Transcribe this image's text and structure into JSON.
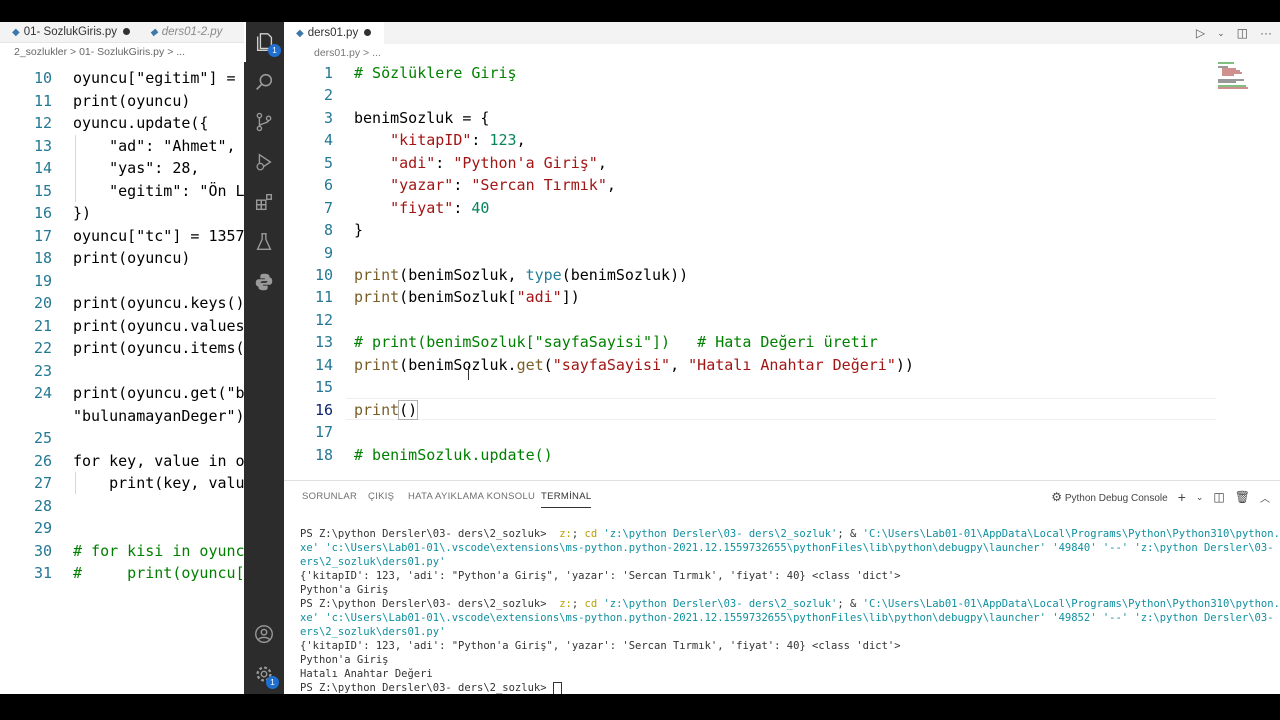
{
  "left_window": {
    "tabs": [
      {
        "label": "01- SozlukGiris.py"
      },
      {
        "label": "ders01-2.py"
      }
    ],
    "breadcrumb": "2_sozlukler  >  01- SozlukGiris.py > ...",
    "lines": [
      {
        "n": "10",
        "code": "oyuncu[\"egitim\"] = "
      },
      {
        "n": "11",
        "code": "print(oyuncu)"
      },
      {
        "n": "12",
        "code": "oyuncu.update({"
      },
      {
        "n": "13",
        "code": "    \"ad\": \"Ahmet\","
      },
      {
        "n": "14",
        "code": "    \"yas\": 28,"
      },
      {
        "n": "15",
        "code": "    \"egitim\": \"Ön L"
      },
      {
        "n": "16",
        "code": "})"
      },
      {
        "n": "17",
        "code": "oyuncu[\"tc\"] = 1357"
      },
      {
        "n": "18",
        "code": "print(oyuncu)"
      },
      {
        "n": "19",
        "code": ""
      },
      {
        "n": "20",
        "code": "print(oyuncu.keys()"
      },
      {
        "n": "21",
        "code": "print(oyuncu.values"
      },
      {
        "n": "22",
        "code": "print(oyuncu.items("
      },
      {
        "n": "23",
        "code": ""
      },
      {
        "n": "24",
        "code": "print(oyuncu.get(\"b"
      },
      {
        "n": "",
        "code": "\"bulunamayanDeger\")"
      },
      {
        "n": "25",
        "code": ""
      },
      {
        "n": "26",
        "code": "for key, value in o"
      },
      {
        "n": "27",
        "code": "    print(key, valu"
      },
      {
        "n": "28",
        "code": ""
      },
      {
        "n": "29",
        "code": ""
      },
      {
        "n": "30",
        "code": "# for kisi in oyunc"
      },
      {
        "n": "31",
        "code": "#     print(oyuncu["
      }
    ]
  },
  "activity_bar": {
    "items": [
      "explorer-icon",
      "search-icon",
      "source-control-icon",
      "run-debug-icon",
      "extensions-icon",
      "testing-icon",
      "python-icon"
    ],
    "explorer_badge": "1",
    "settings_badge": "1",
    "bottom": [
      "account-icon",
      "manage-gear-icon"
    ]
  },
  "editor": {
    "tab_label": "ders01.py",
    "breadcrumb": "ders01.py > ...",
    "line_numbers": [
      "1",
      "2",
      "3",
      "4",
      "5",
      "6",
      "7",
      "8",
      "9",
      "10",
      "11",
      "12",
      "13",
      "14",
      "15",
      "16",
      "17",
      "18"
    ]
  },
  "panel": {
    "tabs": [
      "SORUNLAR",
      "ÇIKIŞ",
      "HATA AYIKLAMA KONSOLU",
      "TERMİNAL"
    ],
    "terminal_name": "Python Debug Console",
    "terminal_lines": [
      [
        {
          "t": "PS Z:\\python Dersler\\03- ders\\2_sozluk> ",
          "c": ""
        },
        {
          "t": " z:",
          "c": "t-y"
        },
        {
          "t": "; ",
          "c": ""
        },
        {
          "t": "cd ",
          "c": "t-y"
        },
        {
          "t": "'z:\\python Dersler\\03- ders\\2_sozluk'",
          "c": "t-c"
        },
        {
          "t": "; & ",
          "c": ""
        },
        {
          "t": "'C:\\Users\\Lab01-01\\AppData\\Local\\Programs\\Python\\Python310\\python.e",
          "c": "t-c"
        }
      ],
      [
        {
          "t": "xe' 'c:\\Users\\Lab01-01\\.vscode\\extensions\\ms-python.python-2021.12.1559732655\\pythonFiles\\lib\\python\\debugpy\\launcher' '49840' '--' 'z:\\python Dersler\\03- d",
          "c": "t-c"
        }
      ],
      [
        {
          "t": "ers\\2_sozluk\\ders01.py'",
          "c": "t-c"
        }
      ],
      [
        {
          "t": "{'kitapID': 123, 'adi': \"Python'a Giriş\", 'yazar': 'Sercan Tırmık', 'fiyat': 40} <class 'dict'>",
          "c": ""
        }
      ],
      [
        {
          "t": "Python'a Giriş",
          "c": ""
        }
      ],
      [
        {
          "t": "PS Z:\\python Dersler\\03- ders\\2_sozluk> ",
          "c": ""
        },
        {
          "t": " z:",
          "c": "t-y"
        },
        {
          "t": "; ",
          "c": ""
        },
        {
          "t": "cd ",
          "c": "t-y"
        },
        {
          "t": "'z:\\python Dersler\\03- ders\\2_sozluk'",
          "c": "t-c"
        },
        {
          "t": "; & ",
          "c": ""
        },
        {
          "t": "'C:\\Users\\Lab01-01\\AppData\\Local\\Programs\\Python\\Python310\\python.e",
          "c": "t-c"
        }
      ],
      [
        {
          "t": "xe' 'c:\\Users\\Lab01-01\\.vscode\\extensions\\ms-python.python-2021.12.1559732655\\pythonFiles\\lib\\python\\debugpy\\launcher' '49852' '--' 'z:\\python Dersler\\03- d",
          "c": "t-c"
        }
      ],
      [
        {
          "t": "ers\\2_sozluk\\ders01.py'",
          "c": "t-c"
        }
      ],
      [
        {
          "t": "{'kitapID': 123, 'adi': \"Python'a Giriş\", 'yazar': 'Sercan Tırmık', 'fiyat': 40} <class 'dict'>",
          "c": ""
        }
      ],
      [
        {
          "t": "Python'a Giriş",
          "c": ""
        }
      ],
      [
        {
          "t": "Hatalı Anahtar Değeri",
          "c": ""
        }
      ],
      [
        {
          "t": "PS Z:\\python Dersler\\03- ders\\2_sozluk> ",
          "c": ""
        }
      ]
    ]
  },
  "code": {
    "l1": "# Sözlüklere Giriş",
    "l3": {
      "var": "benimSozluk",
      "rest": " = {"
    },
    "l4": {
      "key": "\"kitapID\"",
      "val": "123"
    },
    "l5": {
      "key": "\"adi\"",
      "val": "\"Python'a Giriş\""
    },
    "l6": {
      "key": "\"yazar\"",
      "val": "\"Sercan Tırmık\""
    },
    "l7": {
      "key": "\"fiyat\"",
      "val": "40"
    },
    "l8": "}",
    "l10": {
      "fn": "print",
      "arg": "benimSozluk",
      "bi": "type"
    },
    "l11": {
      "fn": "print",
      "arg": "benimSozluk",
      "key": "\"adi\""
    },
    "l13": "# print(benimSozluk[\"sayfaSayisi\"])   # Hata Değeri üretir",
    "l14": {
      "fn": "print",
      "obj": "benimSozluk",
      "m": "get",
      "s1": "\"sayfaSayisi\"",
      "s2": "\"Hatalı Anahtar Değeri\""
    },
    "l16": {
      "fn": "print"
    },
    "l18": "# benimSozluk.update()"
  }
}
